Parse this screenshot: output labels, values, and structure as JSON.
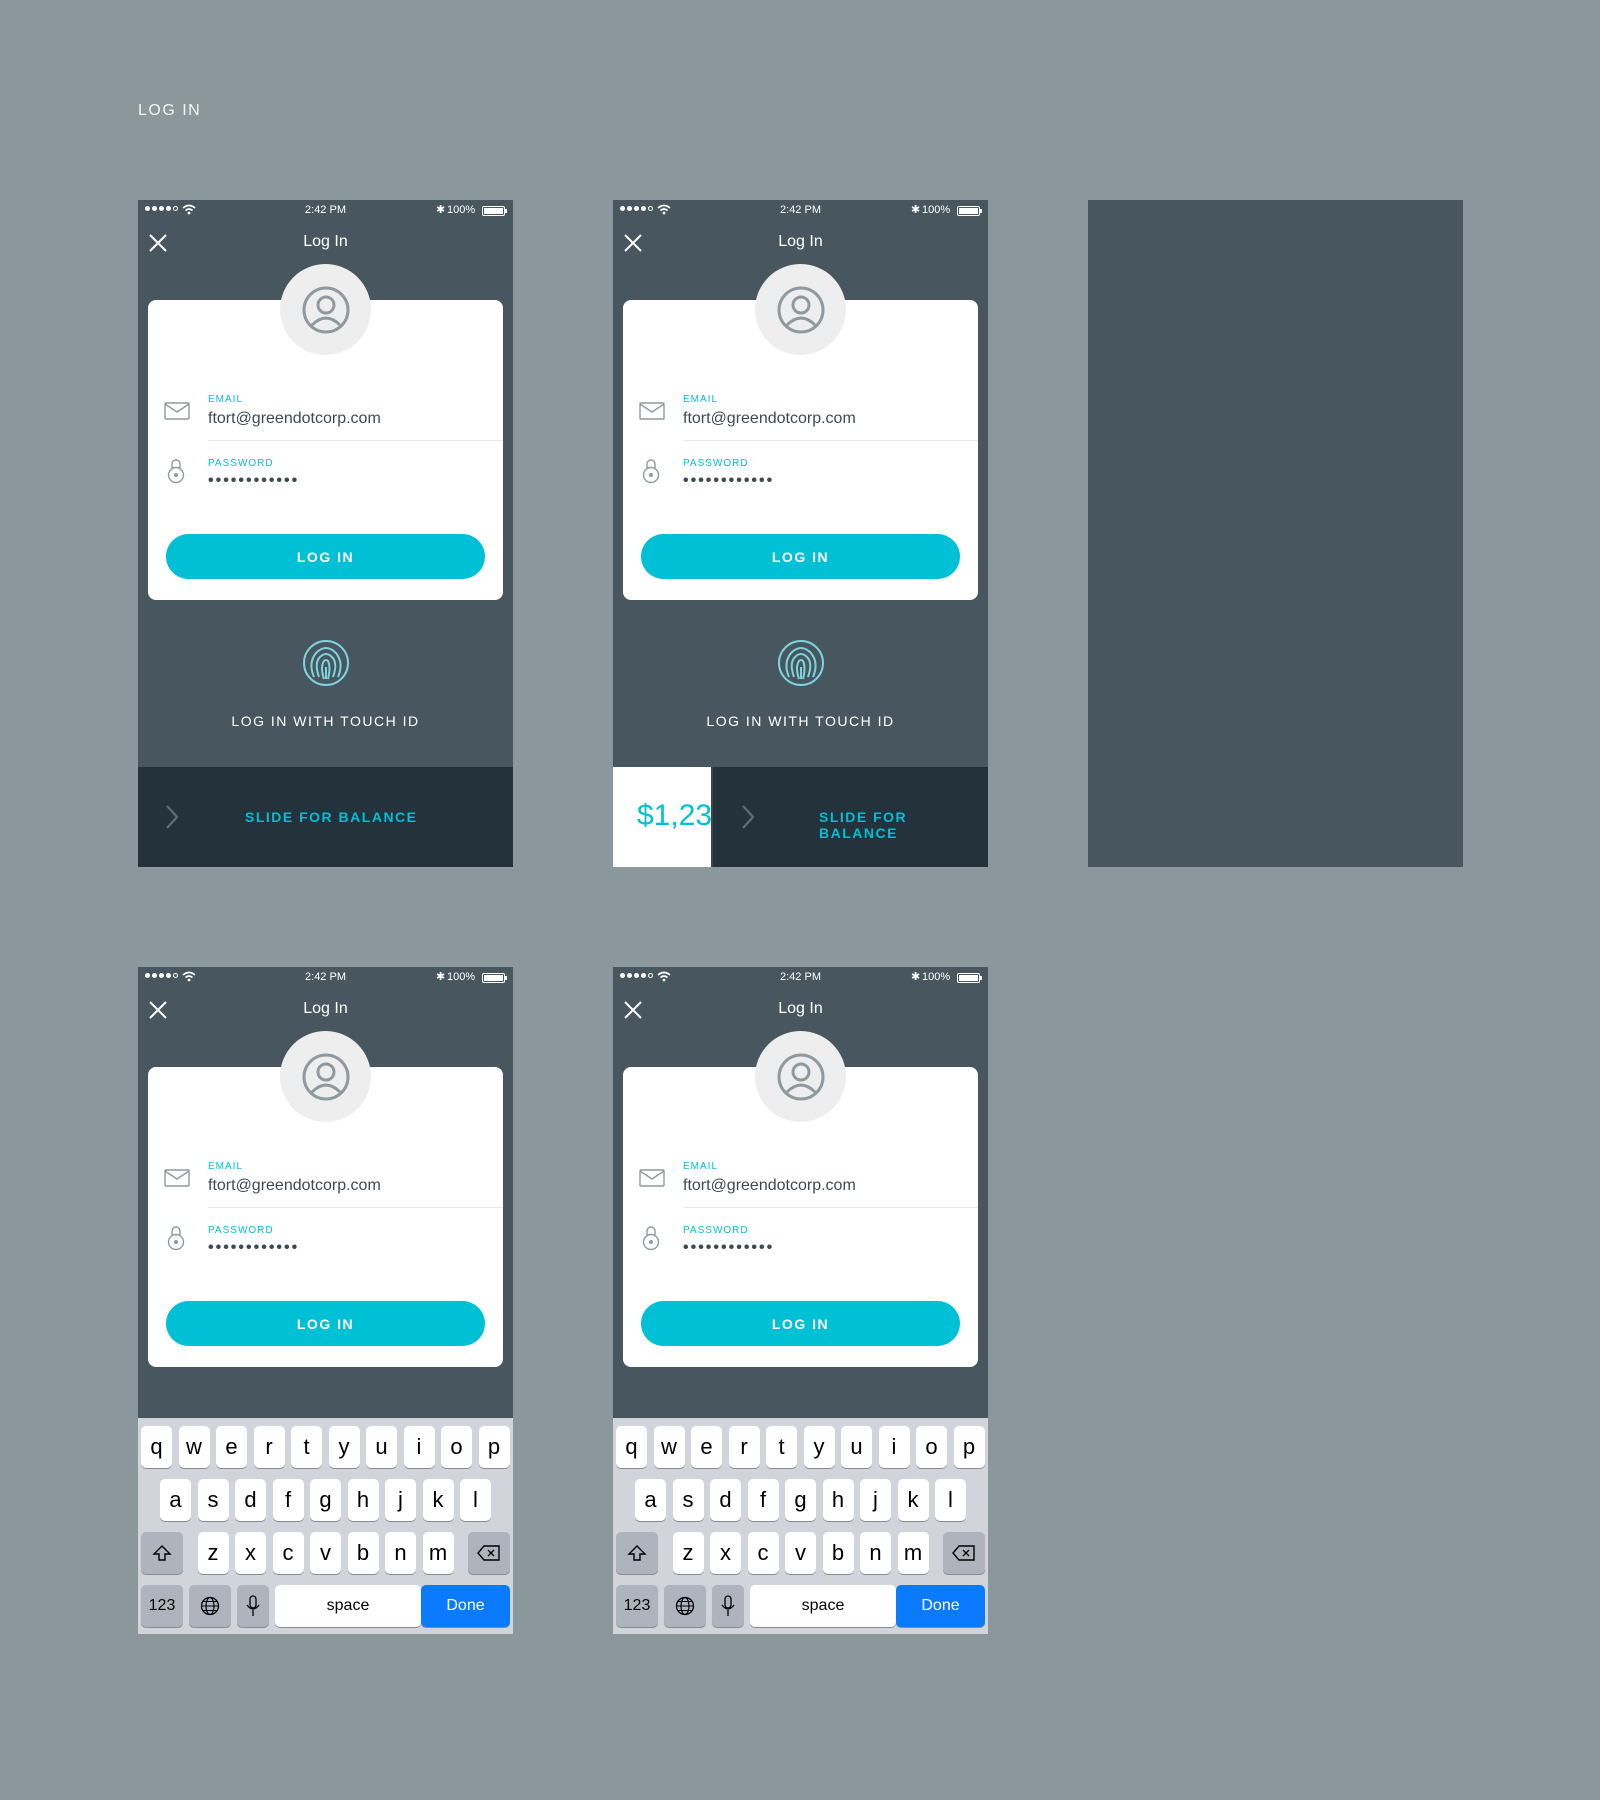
{
  "page": {
    "section_title": "LOG IN"
  },
  "status_bar": {
    "time": "2:42 PM",
    "bluetooth": "✱",
    "battery_text": "100%"
  },
  "nav": {
    "title": "Log In"
  },
  "form": {
    "email_label": "EMAIL",
    "email_value": "ftort@greendotcorp.com",
    "password_label": "PASSWORD",
    "password_dots": "••••••••••••",
    "login_button": "LOG IN"
  },
  "touch_id": {
    "label": "LOG IN WITH TOUCH ID"
  },
  "slide": {
    "label": "SLIDE FOR BALANCE",
    "balance_preview": "$1,23"
  },
  "keyboard": {
    "row1": [
      "q",
      "w",
      "e",
      "r",
      "t",
      "y",
      "u",
      "i",
      "o",
      "p"
    ],
    "row2": [
      "a",
      "s",
      "d",
      "f",
      "g",
      "h",
      "j",
      "k",
      "l"
    ],
    "row3": [
      "z",
      "x",
      "c",
      "v",
      "b",
      "n",
      "m"
    ],
    "numbers_key": "123",
    "space_key": "space",
    "done_key": "Done"
  },
  "colors": {
    "accent": "#00c0d6",
    "page_bg": "#8a979d",
    "screen_bg": "#48575f",
    "slide_bar_bg": "#24323b",
    "keyboard_done": "#0a7aff"
  },
  "icons": [
    "close-icon",
    "user-avatar-icon",
    "mail-icon",
    "lock-icon",
    "fingerprint-icon",
    "chevron-right-icon",
    "shift-icon",
    "backspace-icon",
    "globe-icon",
    "microphone-icon"
  ]
}
